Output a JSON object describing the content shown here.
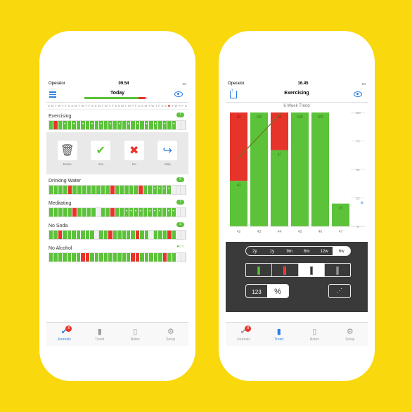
{
  "left": {
    "status": {
      "carrier": "Operator",
      "time": "09.54"
    },
    "nav": {
      "title": "Today",
      "progress_green": 0.85,
      "progress_red": 0.12
    },
    "weekdays": [
      "S",
      "M",
      "T",
      "W",
      "T",
      "F",
      "S",
      "S",
      "M",
      "T",
      "W",
      "T",
      "F",
      "S",
      "S",
      "M",
      "T",
      "W",
      "T",
      "F",
      "S",
      "S",
      "M",
      "T",
      "W",
      "T",
      "F",
      "S",
      "S",
      "M",
      "T",
      "W",
      "T",
      "F",
      "S",
      "S",
      "M",
      "T",
      "W",
      "T",
      "F",
      "S"
    ],
    "weekday_highlight_index": 36,
    "actions": [
      {
        "label": "Erase",
        "icon": "trash-icon"
      },
      {
        "label": "Yes",
        "icon": "check-icon"
      },
      {
        "label": "No",
        "icon": "x-icon"
      },
      {
        "label": "Skip",
        "icon": "skip-icon"
      }
    ],
    "habits": [
      {
        "name": "Exercising",
        "count": "7",
        "cells": "grgdgdgdgdgdgdgdgdgdgdgdgdgdee"
      },
      {
        "name": "Drinking Water",
        "count": "6",
        "cells": "ggggrggggggggrgggggrggddddeee"
      },
      {
        "name": "Meditating",
        "count": "7",
        "cells": "gggggrggggeggrggddddgdddgddee"
      },
      {
        "name": "No Soda",
        "count": "3",
        "cells": "ggrgggggggeggrgggggrggegggrgee"
      },
      {
        "name": "No Alcohol",
        "count": "",
        "cells": "gggggggrrgggggggggrrgggggrggee"
      }
    ],
    "tabs": [
      {
        "label": "Journals",
        "icon": "check-icon",
        "badge": "8"
      },
      {
        "label": "Trend",
        "icon": "bars-icon",
        "badge": ""
      },
      {
        "label": "Notes",
        "icon": "note-icon",
        "badge": ""
      },
      {
        "label": "Setup",
        "icon": "gear-icon",
        "badge": ""
      }
    ]
  },
  "right": {
    "status": {
      "carrier": "Operator",
      "time": "16.45"
    },
    "nav": {
      "title": "Exercising"
    },
    "chart_data": {
      "type": "bar",
      "title": "6 Week Trend",
      "categories": [
        "42",
        "43",
        "44",
        "45",
        "46",
        "47"
      ],
      "series": [
        {
          "values": [
            40,
            100,
            67,
            100,
            100,
            20
          ],
          "color": "#5cc23a"
        },
        {
          "values": [
            60,
            0,
            33,
            0,
            0,
            0
          ],
          "color": "#e6342b"
        }
      ],
      "labels_red": [
        "60",
        "",
        "33",
        "",
        "",
        ""
      ],
      "labels_green": [
        "40",
        "100",
        "67",
        "100",
        "100",
        "20"
      ],
      "y_ticks": [
        "100",
        "75",
        "50",
        "25",
        "%"
      ],
      "ylim": [
        0,
        100
      ]
    },
    "close_label": "×",
    "range_options": [
      "2y",
      "1y",
      "9m",
      "6m",
      "12w",
      "6w"
    ],
    "range_selected": 5,
    "mode_left": "123",
    "mode_right": "%",
    "tabs": [
      {
        "label": "Journals",
        "icon": "check-icon",
        "badge": "8"
      },
      {
        "label": "Trend",
        "icon": "bars-icon",
        "badge": ""
      },
      {
        "label": "Notes",
        "icon": "note-icon",
        "badge": ""
      },
      {
        "label": "Setup",
        "icon": "gear-icon",
        "badge": ""
      }
    ]
  }
}
